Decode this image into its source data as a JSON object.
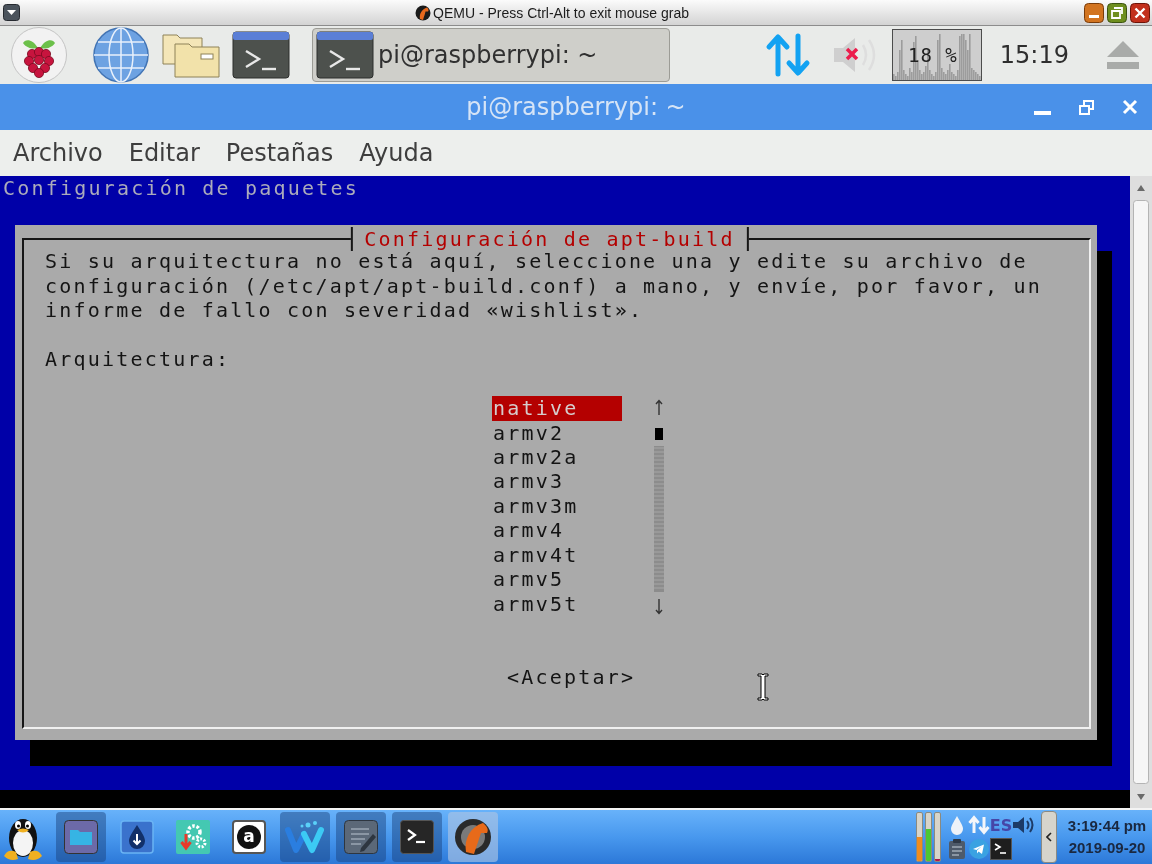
{
  "qemu_window": {
    "title": "QEMU - Press Ctrl-Alt to exit mouse grab"
  },
  "pi_panel": {
    "task_button": {
      "label": "pi@raspberrypi: ~"
    },
    "volume": {
      "muted": true
    },
    "cpu_monitor": {
      "reading": "18 %"
    },
    "clock": "15:19"
  },
  "terminal_window": {
    "title": "pi@raspberrypi: ~",
    "menu": [
      "Archivo",
      "Editar",
      "Pestañas",
      "Ayuda"
    ],
    "backtitle": "Configuración de paquetes",
    "dialog": {
      "title": "Configuración de apt-build",
      "message": "Si su arquitectura no está aquí, seleccione una y edite su archivo de configuración (/etc/apt/apt-build.conf) a mano, y envíe, por favor, un informe de fallo con severidad «wishlist».",
      "prompt": "Arquitectura:",
      "options": [
        {
          "label": "native",
          "selected": true
        },
        {
          "label": "armv2",
          "selected": false
        },
        {
          "label": "armv2a",
          "selected": false
        },
        {
          "label": "armv3",
          "selected": false
        },
        {
          "label": "armv3m",
          "selected": false
        },
        {
          "label": "armv4",
          "selected": false
        },
        {
          "label": "armv4t",
          "selected": false
        },
        {
          "label": "armv5",
          "selected": false
        },
        {
          "label": "armv5t",
          "selected": false
        }
      ],
      "button": "<Aceptar>"
    }
  },
  "host_taskbar": {
    "apps": [
      {
        "kind": "folder",
        "running": true,
        "focused": false
      },
      {
        "kind": "download",
        "running": false,
        "focused": false
      },
      {
        "kind": "gears",
        "running": false,
        "focused": false
      },
      {
        "kind": "letter",
        "glyph": "a",
        "running": false,
        "focused": false
      },
      {
        "kind": "wave",
        "running": true,
        "focused": false
      },
      {
        "kind": "notes",
        "running": true,
        "focused": false
      },
      {
        "kind": "terminal",
        "running": true,
        "focused": false
      },
      {
        "kind": "qemu",
        "running": true,
        "focused": true
      }
    ],
    "meters": [
      {
        "level": 0.5,
        "color": "#f08c1e"
      },
      {
        "level": 0.67,
        "color": "#4cc832"
      },
      {
        "level": 0.04,
        "color": "#b0184a"
      }
    ],
    "keyboard_layout": "ES",
    "clock_time": "3:19:44 pm",
    "clock_date": "2019-09-20"
  }
}
